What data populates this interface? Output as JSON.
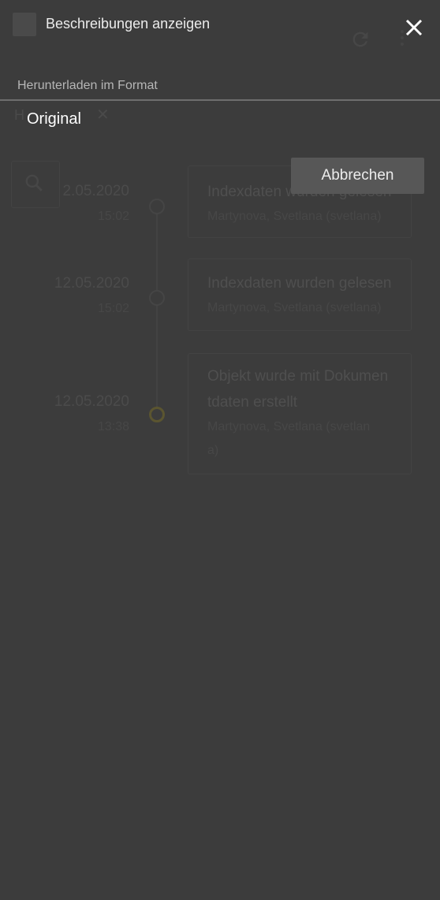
{
  "modal": {
    "show_descriptions_label": "Beschreibungen anzeigen",
    "format_label": "Herunterladen im Format",
    "format_value": "Original",
    "cancel_label": "Abbrechen"
  },
  "background": {
    "chip_label": "H",
    "entries": [
      {
        "date": "2.05.2020",
        "time": "15:02",
        "title": "Indexdaten wurden gelesen",
        "user": "Martynova, Svetlana (svetlana)"
      },
      {
        "date": "12.05.2020",
        "time": "15:02",
        "title": "Indexdaten wurden gelesen",
        "user": "Martynova, Svetlana (svetlana)"
      },
      {
        "date": "12.05.2020",
        "time": "13:38",
        "title_line1": "Objekt wurde mit Dokumen",
        "title_line2": "tdaten erstellt",
        "user_line1": "Martynova, Svetlana (svetlan",
        "user_line2": "a)"
      }
    ]
  },
  "colors": {
    "backdrop": "#3c3c3c",
    "button": "#575757",
    "active_node": "#5b5530"
  }
}
